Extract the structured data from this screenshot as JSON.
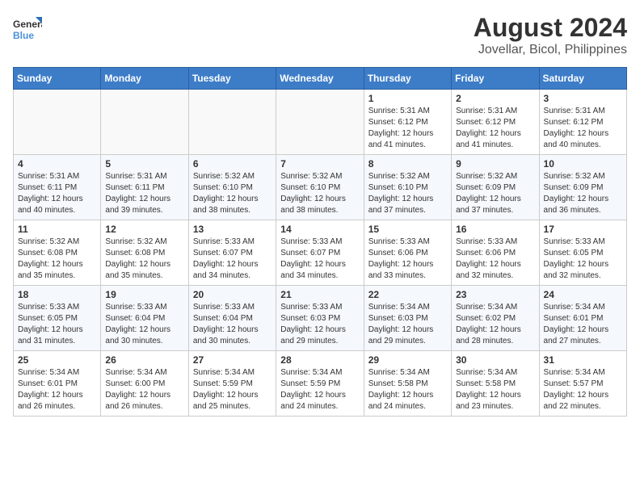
{
  "logo": {
    "text_general": "General",
    "text_blue": "Blue"
  },
  "title": "August 2024",
  "subtitle": "Jovellar, Bicol, Philippines",
  "weekdays": [
    "Sunday",
    "Monday",
    "Tuesday",
    "Wednesday",
    "Thursday",
    "Friday",
    "Saturday"
  ],
  "weeks": [
    [
      {
        "day": "",
        "info": ""
      },
      {
        "day": "",
        "info": ""
      },
      {
        "day": "",
        "info": ""
      },
      {
        "day": "",
        "info": ""
      },
      {
        "day": "1",
        "info": "Sunrise: 5:31 AM\nSunset: 6:12 PM\nDaylight: 12 hours\nand 41 minutes."
      },
      {
        "day": "2",
        "info": "Sunrise: 5:31 AM\nSunset: 6:12 PM\nDaylight: 12 hours\nand 41 minutes."
      },
      {
        "day": "3",
        "info": "Sunrise: 5:31 AM\nSunset: 6:12 PM\nDaylight: 12 hours\nand 40 minutes."
      }
    ],
    [
      {
        "day": "4",
        "info": "Sunrise: 5:31 AM\nSunset: 6:11 PM\nDaylight: 12 hours\nand 40 minutes."
      },
      {
        "day": "5",
        "info": "Sunrise: 5:31 AM\nSunset: 6:11 PM\nDaylight: 12 hours\nand 39 minutes."
      },
      {
        "day": "6",
        "info": "Sunrise: 5:32 AM\nSunset: 6:10 PM\nDaylight: 12 hours\nand 38 minutes."
      },
      {
        "day": "7",
        "info": "Sunrise: 5:32 AM\nSunset: 6:10 PM\nDaylight: 12 hours\nand 38 minutes."
      },
      {
        "day": "8",
        "info": "Sunrise: 5:32 AM\nSunset: 6:10 PM\nDaylight: 12 hours\nand 37 minutes."
      },
      {
        "day": "9",
        "info": "Sunrise: 5:32 AM\nSunset: 6:09 PM\nDaylight: 12 hours\nand 37 minutes."
      },
      {
        "day": "10",
        "info": "Sunrise: 5:32 AM\nSunset: 6:09 PM\nDaylight: 12 hours\nand 36 minutes."
      }
    ],
    [
      {
        "day": "11",
        "info": "Sunrise: 5:32 AM\nSunset: 6:08 PM\nDaylight: 12 hours\nand 35 minutes."
      },
      {
        "day": "12",
        "info": "Sunrise: 5:32 AM\nSunset: 6:08 PM\nDaylight: 12 hours\nand 35 minutes."
      },
      {
        "day": "13",
        "info": "Sunrise: 5:33 AM\nSunset: 6:07 PM\nDaylight: 12 hours\nand 34 minutes."
      },
      {
        "day": "14",
        "info": "Sunrise: 5:33 AM\nSunset: 6:07 PM\nDaylight: 12 hours\nand 34 minutes."
      },
      {
        "day": "15",
        "info": "Sunrise: 5:33 AM\nSunset: 6:06 PM\nDaylight: 12 hours\nand 33 minutes."
      },
      {
        "day": "16",
        "info": "Sunrise: 5:33 AM\nSunset: 6:06 PM\nDaylight: 12 hours\nand 32 minutes."
      },
      {
        "day": "17",
        "info": "Sunrise: 5:33 AM\nSunset: 6:05 PM\nDaylight: 12 hours\nand 32 minutes."
      }
    ],
    [
      {
        "day": "18",
        "info": "Sunrise: 5:33 AM\nSunset: 6:05 PM\nDaylight: 12 hours\nand 31 minutes."
      },
      {
        "day": "19",
        "info": "Sunrise: 5:33 AM\nSunset: 6:04 PM\nDaylight: 12 hours\nand 30 minutes."
      },
      {
        "day": "20",
        "info": "Sunrise: 5:33 AM\nSunset: 6:04 PM\nDaylight: 12 hours\nand 30 minutes."
      },
      {
        "day": "21",
        "info": "Sunrise: 5:33 AM\nSunset: 6:03 PM\nDaylight: 12 hours\nand 29 minutes."
      },
      {
        "day": "22",
        "info": "Sunrise: 5:34 AM\nSunset: 6:03 PM\nDaylight: 12 hours\nand 29 minutes."
      },
      {
        "day": "23",
        "info": "Sunrise: 5:34 AM\nSunset: 6:02 PM\nDaylight: 12 hours\nand 28 minutes."
      },
      {
        "day": "24",
        "info": "Sunrise: 5:34 AM\nSunset: 6:01 PM\nDaylight: 12 hours\nand 27 minutes."
      }
    ],
    [
      {
        "day": "25",
        "info": "Sunrise: 5:34 AM\nSunset: 6:01 PM\nDaylight: 12 hours\nand 26 minutes."
      },
      {
        "day": "26",
        "info": "Sunrise: 5:34 AM\nSunset: 6:00 PM\nDaylight: 12 hours\nand 26 minutes."
      },
      {
        "day": "27",
        "info": "Sunrise: 5:34 AM\nSunset: 5:59 PM\nDaylight: 12 hours\nand 25 minutes."
      },
      {
        "day": "28",
        "info": "Sunrise: 5:34 AM\nSunset: 5:59 PM\nDaylight: 12 hours\nand 24 minutes."
      },
      {
        "day": "29",
        "info": "Sunrise: 5:34 AM\nSunset: 5:58 PM\nDaylight: 12 hours\nand 24 minutes."
      },
      {
        "day": "30",
        "info": "Sunrise: 5:34 AM\nSunset: 5:58 PM\nDaylight: 12 hours\nand 23 minutes."
      },
      {
        "day": "31",
        "info": "Sunrise: 5:34 AM\nSunset: 5:57 PM\nDaylight: 12 hours\nand 22 minutes."
      }
    ]
  ]
}
